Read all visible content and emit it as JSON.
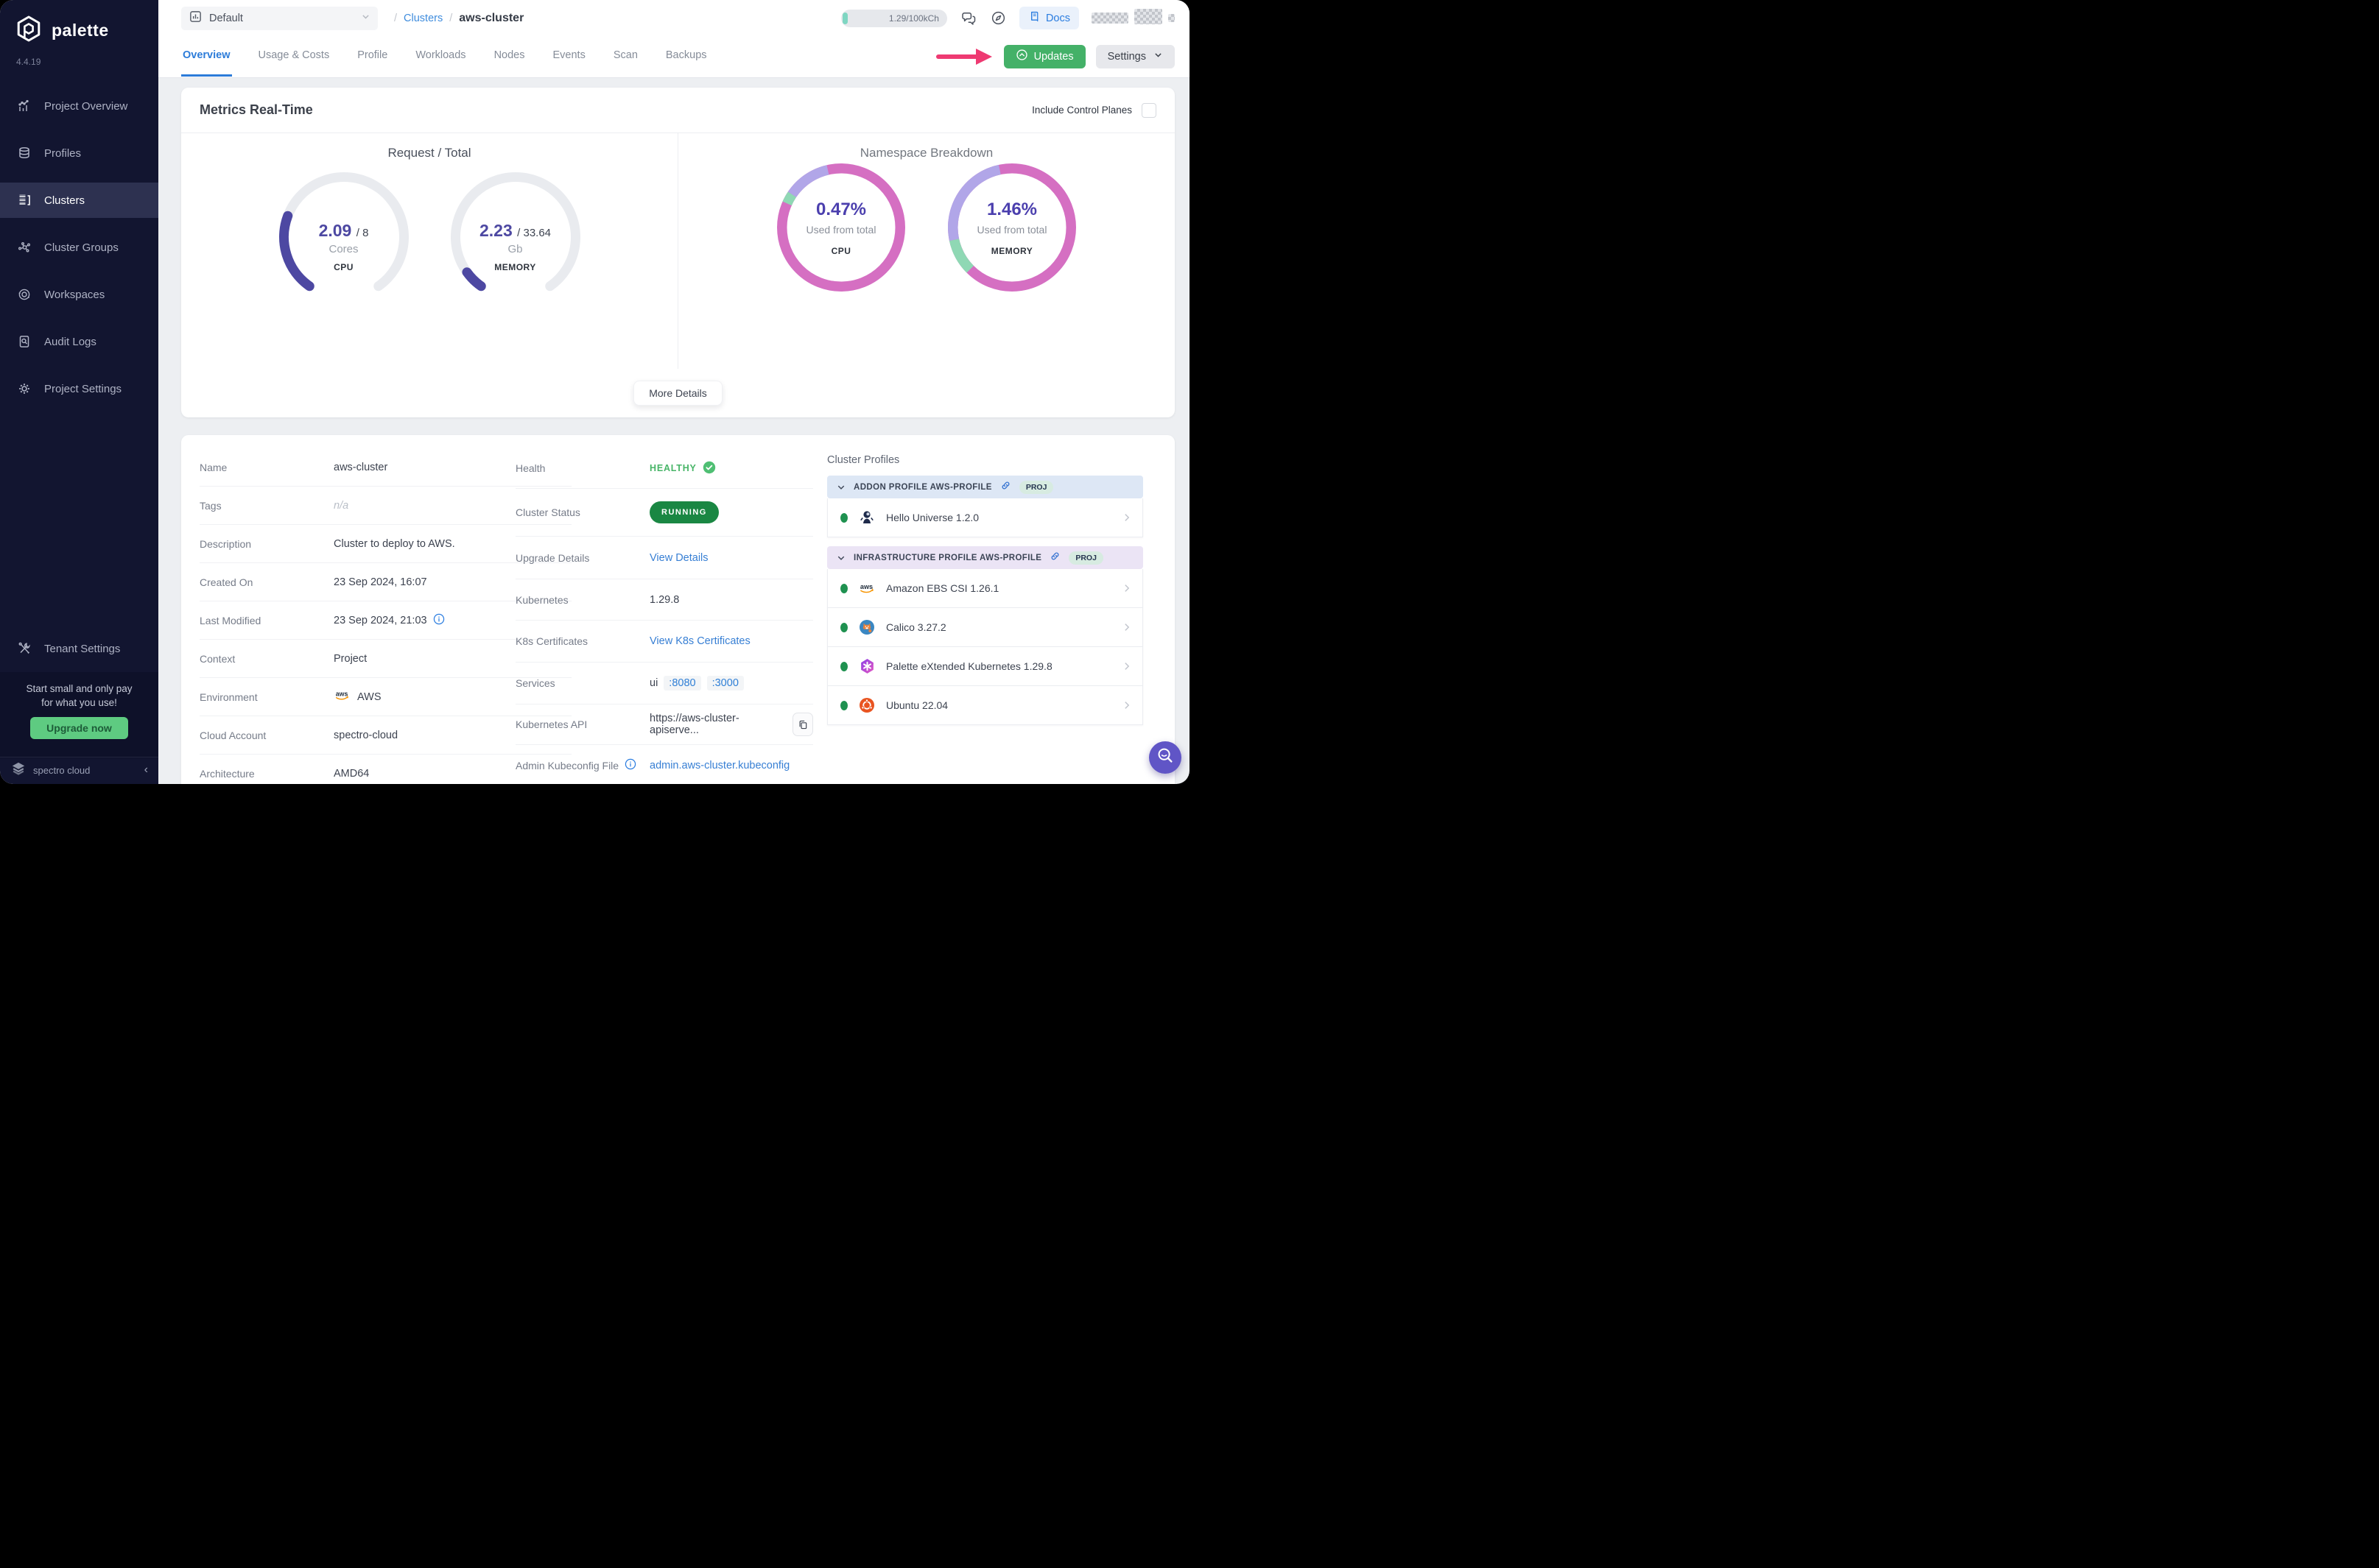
{
  "app": {
    "name": "palette",
    "version": "4.4.19"
  },
  "sidebar": {
    "items": [
      {
        "label": "Project Overview",
        "icon": "chart-icon"
      },
      {
        "label": "Profiles",
        "icon": "layers-icon"
      },
      {
        "label": "Clusters",
        "icon": "clusters-icon",
        "active": true
      },
      {
        "label": "Cluster Groups",
        "icon": "network-icon"
      },
      {
        "label": "Workspaces",
        "icon": "orbit-icon"
      },
      {
        "label": "Audit Logs",
        "icon": "audit-icon"
      },
      {
        "label": "Project Settings",
        "icon": "gear-icon"
      }
    ],
    "tenant": {
      "label": "Tenant Settings",
      "icon": "tools-icon"
    },
    "promo": {
      "line1": "Start small and only pay",
      "line2": "for what you use!",
      "button": "Upgrade now"
    },
    "footer": {
      "brand": "spectro cloud",
      "collapse": "‹"
    }
  },
  "topbar": {
    "project_selector": {
      "label": "Default"
    },
    "breadcrumb": {
      "separator": "/",
      "section": "Clusters",
      "current": "aws-cluster"
    },
    "usage_pill": "1.29/100kCh",
    "docs_label": "Docs"
  },
  "tabs": {
    "items": [
      "Overview",
      "Usage & Costs",
      "Profile",
      "Workloads",
      "Nodes",
      "Events",
      "Scan",
      "Backups"
    ],
    "active": "Overview",
    "updates_label": "Updates",
    "settings_label": "Settings"
  },
  "metrics": {
    "title": "Metrics Real-Time",
    "include_control_planes": "Include Control Planes",
    "request_total": {
      "title": "Request / Total",
      "gauges": [
        {
          "value": "2.09",
          "total": "/ 8",
          "unit": "Cores",
          "label": "CPU",
          "fraction": 0.261
        },
        {
          "value": "2.23",
          "total": "/ 33.64",
          "unit": "Gb",
          "label": "MEMORY",
          "fraction": 0.066
        }
      ]
    },
    "namespace": {
      "title": "Namespace Breakdown",
      "rings": [
        {
          "percent": "0.47%",
          "caption": "Used from total",
          "label": "CPU",
          "base": "#d56fc2",
          "segments": [
            {
              "color": "#8fd8b4",
              "start": 294,
              "end": 304
            },
            {
              "color": "#b1a6e8",
              "start": 304,
              "end": 347
            }
          ]
        },
        {
          "percent": "1.46%",
          "caption": "Used from total",
          "label": "MEMORY",
          "base": "#d56fc2",
          "segments": [
            {
              "color": "#8fd8b4",
              "start": 225,
              "end": 258
            },
            {
              "color": "#b1a6e8",
              "start": 258,
              "end": 348
            }
          ]
        }
      ]
    },
    "more_details": "More Details"
  },
  "details": {
    "left": [
      {
        "label": "Name",
        "value": "aws-cluster"
      },
      {
        "label": "Tags",
        "value": "n/a"
      },
      {
        "label": "Description",
        "value": "Cluster to deploy to AWS."
      },
      {
        "label": "Created On",
        "value": "23 Sep 2024, 16:07"
      },
      {
        "label": "Last Modified",
        "value": "23 Sep 2024, 21:03"
      },
      {
        "label": "Context",
        "value": "Project"
      },
      {
        "label": "Environment",
        "value": "AWS"
      },
      {
        "label": "Cloud Account",
        "value": "spectro-cloud"
      },
      {
        "label": "Architecture",
        "value": "AMD64"
      }
    ],
    "middle": {
      "health": {
        "label": "Health",
        "value": "HEALTHY"
      },
      "status": {
        "label": "Cluster Status",
        "value": "RUNNING"
      },
      "upgrade": {
        "label": "Upgrade Details",
        "link": "View Details"
      },
      "kubernetes": {
        "label": "Kubernetes",
        "value": "1.29.8"
      },
      "certificates": {
        "label": "K8s Certificates",
        "link": "View K8s Certificates"
      },
      "services": {
        "label": "Services",
        "name": "ui",
        "ports": [
          ":8080",
          ":3000"
        ]
      },
      "api": {
        "label": "Kubernetes API",
        "value": "https://aws-cluster-apiserve..."
      },
      "kubeconfig": {
        "label": "Admin Kubeconfig File",
        "link": "admin.aws-cluster.kubeconfig"
      }
    }
  },
  "profiles": {
    "title": "Cluster Profiles",
    "groups": [
      {
        "header": "ADDON PROFILE AWS-PROFILE",
        "badge": "PROJ",
        "items": [
          {
            "name": "Hello Universe 1.2.0",
            "icon": "hello-universe-icon"
          }
        ]
      },
      {
        "header": "INFRASTRUCTURE PROFILE AWS-PROFILE",
        "badge": "PROJ",
        "items": [
          {
            "name": "Amazon EBS CSI 1.26.1",
            "icon": "aws-icon"
          },
          {
            "name": "Calico 3.27.2",
            "icon": "calico-icon"
          },
          {
            "name": "Palette eXtended Kubernetes 1.29.8",
            "icon": "pxk-icon"
          },
          {
            "name": "Ubuntu 22.04",
            "icon": "ubuntu-icon"
          }
        ]
      }
    ]
  },
  "colors": {
    "accent_green": "#44b168",
    "brand_navy": "#121530",
    "link_blue": "#377fd4",
    "gauge_purple": "#4d48a2",
    "ring_pink": "#d56fc2",
    "arrow_pink": "#ee3a72"
  }
}
